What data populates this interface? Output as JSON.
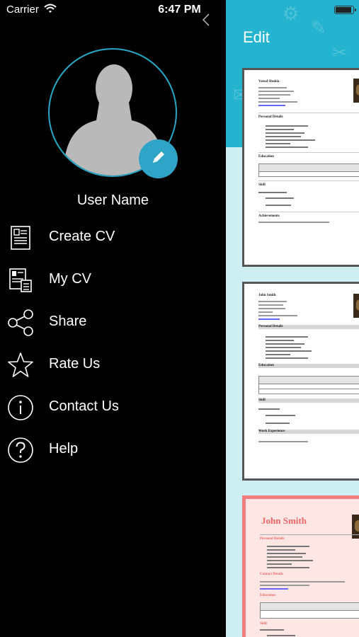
{
  "status_bar": {
    "carrier": "Carrier",
    "time": "6:47 PM"
  },
  "drawer": {
    "user_name": "User Name",
    "menu": [
      {
        "label": "Create CV",
        "icon": "create-cv-icon"
      },
      {
        "label": "My CV",
        "icon": "my-cv-icon"
      },
      {
        "label": "Share",
        "icon": "share-icon"
      },
      {
        "label": "Rate Us",
        "icon": "star-icon"
      },
      {
        "label": "Contact Us",
        "icon": "info-icon"
      },
      {
        "label": "Help",
        "icon": "question-icon"
      }
    ]
  },
  "content": {
    "title": "Edit",
    "templates": [
      {
        "name": "Vatsal Shukla",
        "section_1": "Personal Details",
        "section_2": "Education",
        "section_3": "Skill",
        "section_4": "Achievements"
      },
      {
        "name": "John Smith",
        "section_1": "Personal Details",
        "section_2": "Education",
        "section_3": "Skill",
        "section_4": "Work Experience"
      },
      {
        "name": "John Smith",
        "section_1": "Personal Details",
        "section_2": "Contact Details",
        "section_3": "Education",
        "section_4": "Skill"
      }
    ]
  },
  "colors": {
    "accent": "#2fa4c6",
    "drawer_bg": "#000000",
    "header_band": "#25b4cf",
    "content_bg": "#cdeef3",
    "template3_accent": "#f08080"
  }
}
